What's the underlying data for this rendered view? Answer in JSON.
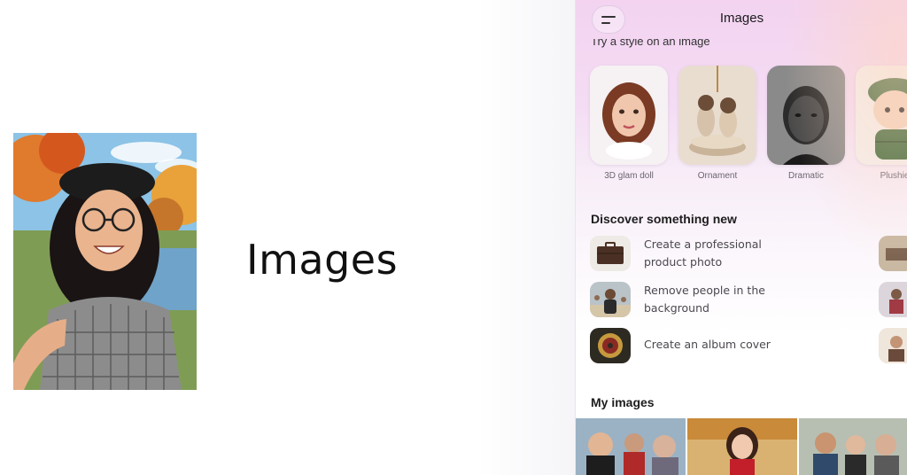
{
  "promo": {
    "title": "Images"
  },
  "app": {
    "title": "Images",
    "styles_section_title": "Try a style on an image",
    "styles": [
      {
        "label": "3D glam doll",
        "icon": "glam-doll-portrait"
      },
      {
        "label": "Ornament",
        "icon": "cats-ornament"
      },
      {
        "label": "Dramatic",
        "icon": "dramatic-portrait"
      },
      {
        "label": "Plushie",
        "icon": "plushie-figure"
      }
    ],
    "discover_title": "Discover something new",
    "discover_items": [
      {
        "label": "Create a professional product photo",
        "icon": "suitcase-photo"
      },
      {
        "label": "Remove people in the background",
        "icon": "beach-person-photo"
      },
      {
        "label": "Create an album cover",
        "icon": "album-cover-photo"
      }
    ],
    "my_images_title": "My images",
    "colors": {
      "gradient_top": "#f3d3f0",
      "gradient_mid": "#f7ecf7",
      "text_dark": "#1d1d1d",
      "text_muted": "#6a6470"
    }
  }
}
